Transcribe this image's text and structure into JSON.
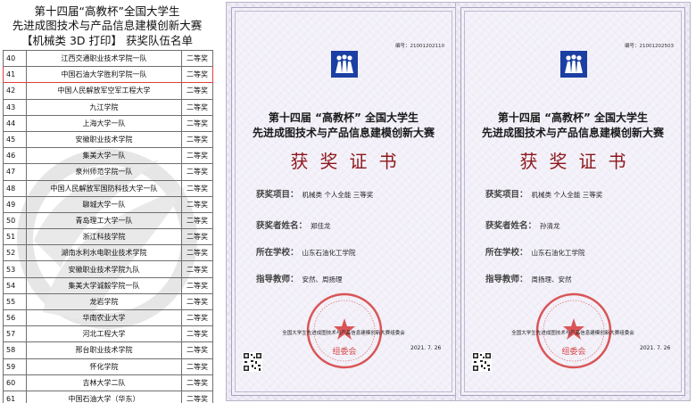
{
  "left_panel": {
    "title_line1": "第十四届“高教杯”全国大学生",
    "title_line2": "先进成图技术与产品信息建模创新大赛",
    "title_line3": "【机械类  3D  打印】    获奖队伍名单",
    "rows": [
      {
        "num": "40",
        "school": "江西交通职业技术学院一队",
        "award": "二等奖"
      },
      {
        "num": "41",
        "school": "中国石油大学胜利学院一队",
        "award": "二等奖"
      },
      {
        "num": "42",
        "school": "中国人民解放军空军工程大学",
        "award": "二等奖"
      },
      {
        "num": "43",
        "school": "九江学院",
        "award": "二等奖"
      },
      {
        "num": "44",
        "school": "上海大学一队",
        "award": "二等奖"
      },
      {
        "num": "45",
        "school": "安徽职业技术学院",
        "award": "二等奖"
      },
      {
        "num": "46",
        "school": "集美大学一队",
        "award": "二等奖"
      },
      {
        "num": "47",
        "school": "泉州师范学院一队",
        "award": "二等奖"
      },
      {
        "num": "48",
        "school": "中国人民解放军国防科技大学一队",
        "award": "二等奖"
      },
      {
        "num": "49",
        "school": "聊城大学一队",
        "award": "二等奖"
      },
      {
        "num": "50",
        "school": "青岛理工大学一队",
        "award": "二等奖"
      },
      {
        "num": "51",
        "school": "浙江科技学院",
        "award": "二等奖"
      },
      {
        "num": "52",
        "school": "湖南水利水电职业技术学院",
        "award": "二等奖"
      },
      {
        "num": "53",
        "school": "安徽职业技术学院九队",
        "award": "二等奖"
      },
      {
        "num": "54",
        "school": "集美大学诚毅学院一队",
        "award": "二等奖"
      },
      {
        "num": "55",
        "school": "龙岩学院",
        "award": "二等奖"
      },
      {
        "num": "56",
        "school": "华南农业大学",
        "award": "二等奖"
      },
      {
        "num": "57",
        "school": "河北工程大学",
        "award": "二等奖"
      },
      {
        "num": "58",
        "school": "邢台职业技术学院",
        "award": "二等奖"
      },
      {
        "num": "59",
        "school": "怀化学院",
        "award": "二等奖"
      },
      {
        "num": "60",
        "school": "吉林大学二队",
        "award": "二等奖"
      },
      {
        "num": "61",
        "school": "中国石油大学（华东）",
        "award": "二等奖"
      }
    ]
  },
  "certificates": [
    {
      "cert_no": "编号：21001202110",
      "title_line1": "第十四届 “高教杯” 全国大学生",
      "title_line2": "先进成图技术与产品信息建模创新大赛",
      "main_title": "获奖证书",
      "project_label": "获奖项目：",
      "project_value": "机械类  个人全能  三等奖",
      "name_label": "获奖者姓名：",
      "name_value": "郑佳龙",
      "school_label": "所在学校：",
      "school_value": "山东石油化工学院",
      "teacher_label": "指导教师：",
      "teacher_value": "安然、周扬理",
      "committee": "全国大学生先进成图技术与产品信息建模创新大赛组委会",
      "date": "2021. 7. 26",
      "seal_text": "组委会"
    },
    {
      "cert_no": "编号：21001202503",
      "title_line1": "第十四届 “高教杯” 全国大学生",
      "title_line2": "先进成图技术与产品信息建模创新大赛",
      "main_title": "获奖证书",
      "project_label": "获奖项目：",
      "project_value": "机械类  个人全能  三等奖",
      "name_label": "获奖者姓名：",
      "name_value": "孙清龙",
      "school_label": "所在学校：",
      "school_value": "山东石油化工学院",
      "teacher_label": "指导教师：",
      "teacher_value": "周扬理、安然",
      "committee": "全国大学生先进成图技术与产品信息建模创新大赛组委会",
      "date": "2021. 7. 26",
      "seal_text": "组委会"
    }
  ],
  "colors": {
    "logo_blue": "#1b3fa3",
    "seal_red": "#d22a2a",
    "main_title_red": "#8d171b",
    "highlight_row": "#e04040"
  }
}
